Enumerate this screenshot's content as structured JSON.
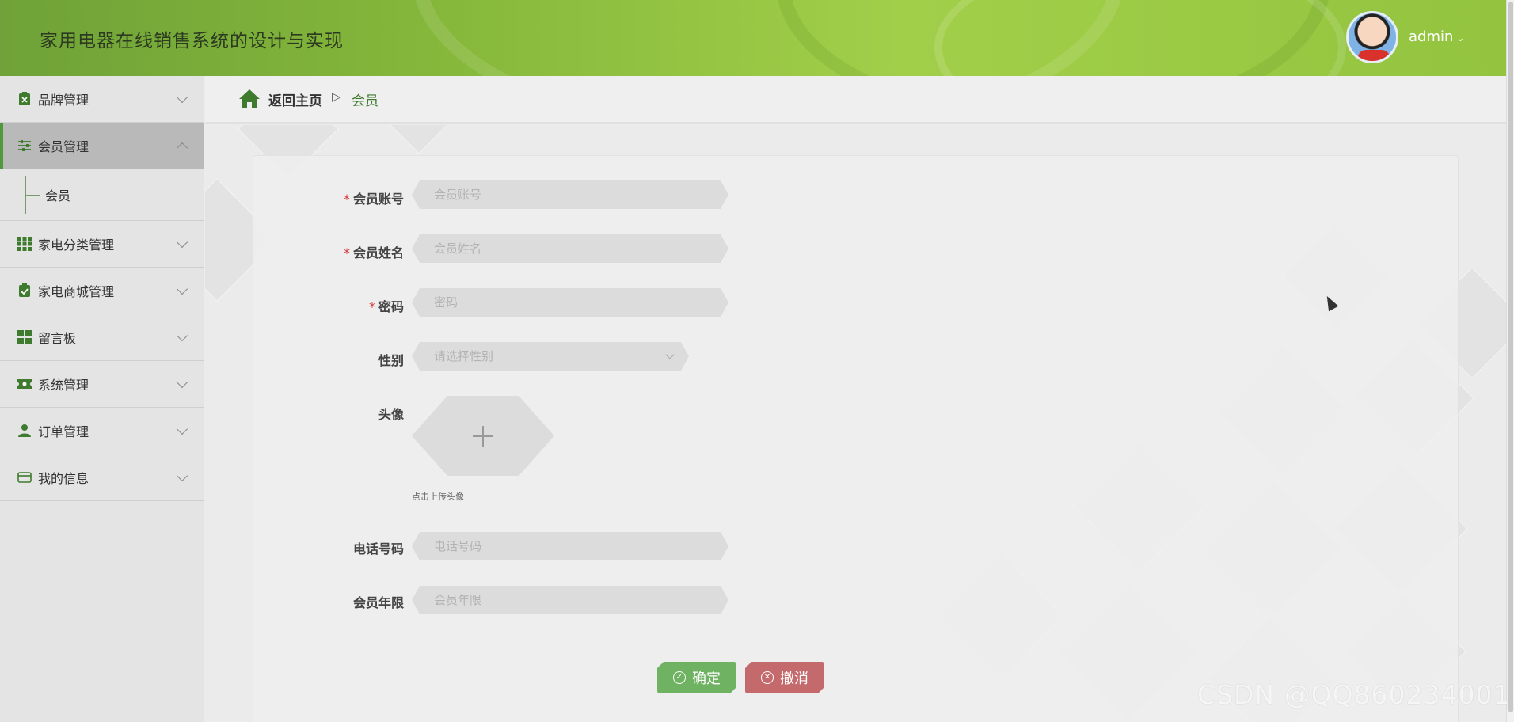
{
  "header": {
    "title": "家用电器在线销售系统的设计与实现",
    "username": "admin",
    "caret": "⌄"
  },
  "sidebar": {
    "items": [
      {
        "label": "品牌管理",
        "icon": "brand-icon",
        "expanded": false
      },
      {
        "label": "会员管理",
        "icon": "sliders-icon",
        "expanded": true,
        "children": [
          {
            "label": "会员"
          }
        ]
      },
      {
        "label": "家电分类管理",
        "icon": "grid-icon",
        "expanded": false
      },
      {
        "label": "家电商城管理",
        "icon": "clipboard-check-icon",
        "expanded": false
      },
      {
        "label": "留言板",
        "icon": "dashboard-icon",
        "expanded": false
      },
      {
        "label": "系统管理",
        "icon": "ticket-icon",
        "expanded": false
      },
      {
        "label": "订单管理",
        "icon": "user-icon",
        "expanded": false
      },
      {
        "label": "我的信息",
        "icon": "card-icon",
        "expanded": false
      }
    ]
  },
  "breadcrumb": {
    "home": "返回主页",
    "separator": "▷",
    "current": "会员"
  },
  "form": {
    "account": {
      "label": "会员账号",
      "placeholder": "会员账号",
      "required": true
    },
    "name": {
      "label": "会员姓名",
      "placeholder": "会员姓名",
      "required": true
    },
    "password": {
      "label": "密码",
      "placeholder": "密码",
      "required": true
    },
    "gender": {
      "label": "性别",
      "placeholder": "请选择性别",
      "required": false
    },
    "avatar": {
      "label": "头像",
      "hint": "点击上传头像"
    },
    "phone": {
      "label": "电话号码",
      "placeholder": "电话号码",
      "required": false
    },
    "years": {
      "label": "会员年限",
      "placeholder": "会员年限",
      "required": false
    },
    "required_mark": "*",
    "submit_label": "确定",
    "cancel_label": "撤消"
  },
  "watermark": "CSDN @QQ860234001",
  "colors": {
    "accent": "#4e9a3a",
    "header_green": "#86b83b",
    "ok_button": "#6fb261",
    "cancel_button": "#c46a6d",
    "required": "#d8393a"
  }
}
